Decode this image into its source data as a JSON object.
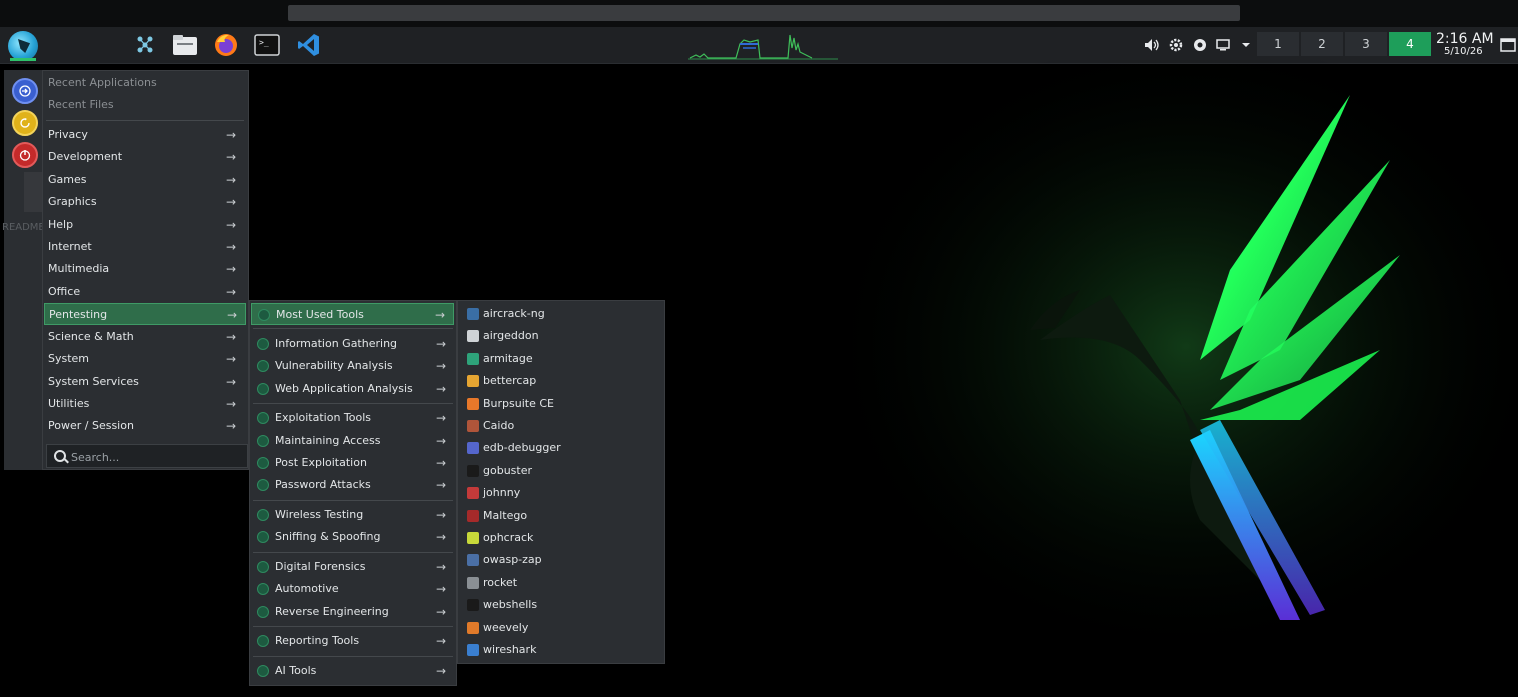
{
  "taskbar": {
    "workspaces": [
      "1",
      "2",
      "3",
      "4"
    ],
    "active_workspace": "4",
    "clock_time": "2:16 AM",
    "clock_date": "5/10/26",
    "icons": [
      "parrot-menu-icon",
      "network-manager-icon",
      "file-manager-icon",
      "firefox-icon",
      "terminal-icon",
      "vscode-icon",
      "volume-icon",
      "settings-icon",
      "record-icon",
      "display-icon",
      "dropdown-icon",
      "show-desktop-icon"
    ],
    "accent": "#1e9e5a"
  },
  "menu": {
    "recent": [
      "Recent Applications",
      "Recent Files"
    ],
    "categories": [
      "Privacy",
      "Development",
      "Games",
      "Graphics",
      "Help",
      "Internet",
      "Multimedia",
      "Office",
      "Pentesting",
      "Science & Math",
      "System",
      "System Services",
      "Utilities",
      "Power / Session"
    ],
    "selected_category": "Pentesting",
    "search_placeholder": "Search...",
    "side_buttons": [
      "switch-user-icon",
      "lock-screen-icon",
      "power-icon"
    ]
  },
  "pentesting": {
    "groups": [
      [
        "Most Used Tools"
      ],
      [
        "Information Gathering",
        "Vulnerability Analysis",
        "Web Application Analysis"
      ],
      [
        "Exploitation Tools",
        "Maintaining Access",
        "Post Exploitation",
        "Password Attacks"
      ],
      [
        "Wireless Testing",
        "Sniffing & Spoofing"
      ],
      [
        "Digital Forensics",
        "Automotive",
        "Reverse Engineering"
      ],
      [
        "Reporting Tools"
      ],
      [
        "AI Tools"
      ]
    ],
    "selected": "Most Used Tools"
  },
  "most_used": {
    "tools": [
      "aircrack-ng",
      "airgeddon",
      "armitage",
      "bettercap",
      "Burpsuite CE",
      "Caido",
      "edb-debugger",
      "gobuster",
      "johnny",
      "Maltego",
      "ophcrack",
      "owasp-zap",
      "rocket",
      "webshells",
      "weevely",
      "wireshark"
    ],
    "icon_colors": [
      "#3a6ea5",
      "#cfd3d6",
      "#2ea37a",
      "#e6a532",
      "#e8782a",
      "#b0553a",
      "#5566cc",
      "#1a1a1a",
      "#c43a3a",
      "#a52a2a",
      "#c7d83a",
      "#4a6fa5",
      "#8a8f94",
      "#1a1a1a",
      "#e07a2a",
      "#3a7fd0"
    ]
  },
  "desktop": {
    "ghost_label": "README.license"
  }
}
